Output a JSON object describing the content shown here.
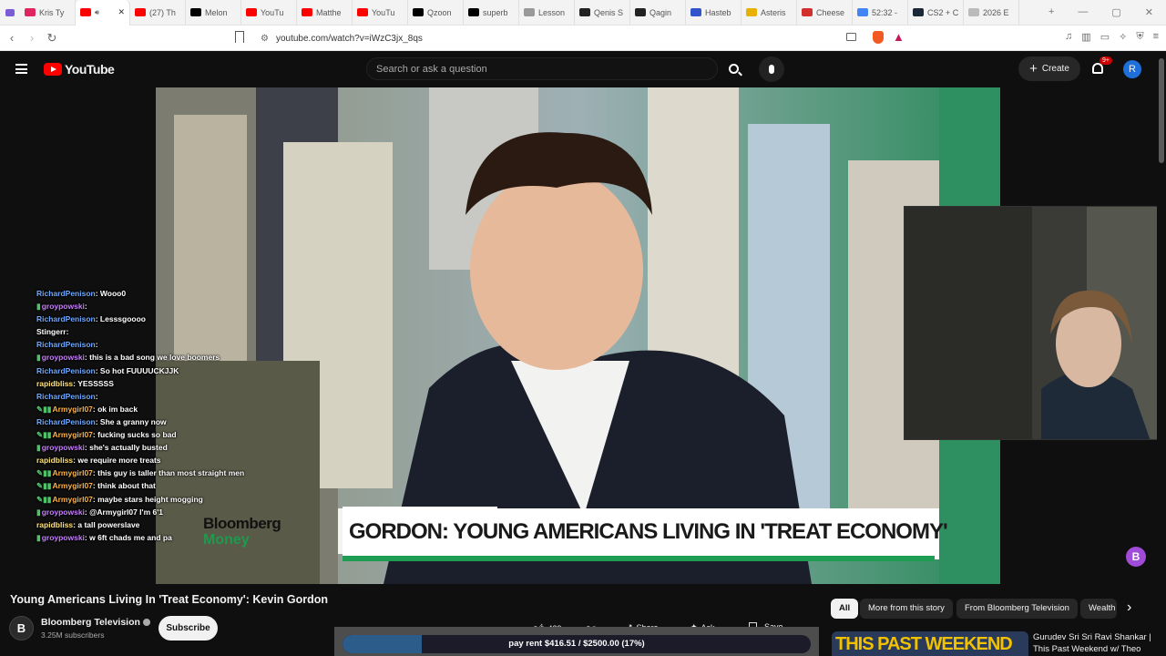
{
  "browser": {
    "tabs": [
      {
        "label": "Kris Ty",
        "color": "#e0245e"
      },
      {
        "label": "",
        "color": "#ff0000",
        "active": true
      },
      {
        "label": "(27) Th",
        "color": "#ff0000"
      },
      {
        "label": "Melon",
        "color": "#000000"
      },
      {
        "label": "YouTu",
        "color": "#ff0000"
      },
      {
        "label": "Matthe",
        "color": "#ff0000"
      },
      {
        "label": "YouTu",
        "color": "#ff0000"
      },
      {
        "label": "Qzoon",
        "color": "#000000"
      },
      {
        "label": "superb",
        "color": "#000000"
      },
      {
        "label": "Lesson",
        "color": "#999999"
      },
      {
        "label": "Qenis S",
        "color": "#222222"
      },
      {
        "label": "Qagin",
        "color": "#222222"
      },
      {
        "label": "Hasteb",
        "color": "#3355cc"
      },
      {
        "label": "Asteris",
        "color": "#e8b100"
      },
      {
        "label": "Cheese",
        "color": "#d32f2f"
      },
      {
        "label": "52:32 -",
        "color": "#4285f4"
      },
      {
        "label": "CS2 + C",
        "color": "#1b2838"
      },
      {
        "label": "2026 E",
        "color": "#bbbbbb"
      }
    ],
    "url": "youtube.com/watch?v=iWzC3jx_8qs"
  },
  "yt": {
    "logo": "YouTube",
    "search_placeholder": "Search or ask a question",
    "create": "Create",
    "notif_count": "9+",
    "avatar": "R"
  },
  "video": {
    "brand_top": "Bloomberg",
    "brand_bottom": "Money",
    "headline": "GORDON: YOUNG AMERICANS LIVING IN 'TREAT ECONOMY'"
  },
  "chat": [
    {
      "user": "RichardPenison",
      "msg": "Wooo0",
      "color": "#6ea8ff",
      "badges": ""
    },
    {
      "user": "groypowski",
      "msg": "",
      "color": "#c77dff",
      "badges": "▮"
    },
    {
      "user": "RichardPenison",
      "msg": "Lesssgoooo",
      "color": "#6ea8ff",
      "badges": ""
    },
    {
      "user": "Stingerr",
      "msg": "",
      "color": "#ffffff",
      "badges": ""
    },
    {
      "user": "RichardPenison",
      "msg": "",
      "color": "#6ea8ff",
      "badges": ""
    },
    {
      "user": "groypowski",
      "msg": "this is a bad song we love boomers",
      "color": "#c77dff",
      "badges": "▮"
    },
    {
      "user": "RichardPenison",
      "msg": "So hot FUUUUCKJJK",
      "color": "#6ea8ff",
      "badges": ""
    },
    {
      "user": "rapidbliss",
      "msg": "YESSSSS",
      "color": "#ffe37a",
      "badges": ""
    },
    {
      "user": "RichardPenison",
      "msg": "",
      "color": "#6ea8ff",
      "badges": ""
    },
    {
      "user": "Armygirl07",
      "msg": "ok im back",
      "color": "#ffb347",
      "badges": "✎▮▮"
    },
    {
      "user": "RichardPenison",
      "msg": "She a granny now",
      "color": "#6ea8ff",
      "badges": ""
    },
    {
      "user": "Armygirl07",
      "msg": "fucking sucks so bad",
      "color": "#ffb347",
      "badges": "✎▮▮"
    },
    {
      "user": "groypowski",
      "msg": "she's actually busted",
      "color": "#c77dff",
      "badges": "▮"
    },
    {
      "user": "rapidbliss",
      "msg": "we require more treats",
      "color": "#ffe37a",
      "badges": ""
    },
    {
      "user": "Armygirl07",
      "msg": "this guy is taller than most straight men",
      "color": "#ffb347",
      "badges": "✎▮▮"
    },
    {
      "user": "Armygirl07",
      "msg": "think about that",
      "color": "#ffb347",
      "badges": "✎▮▮"
    },
    {
      "user": "Armygirl07",
      "msg": "maybe stars height mogging",
      "color": "#ffb347",
      "badges": "✎▮▮"
    },
    {
      "user": "groypowski",
      "msg": "@Armygirl07 I'm 6'1",
      "color": "#c77dff",
      "badges": "▮"
    },
    {
      "user": "rapidbliss",
      "msg": "a tall powerslave",
      "color": "#ffe37a",
      "badges": ""
    },
    {
      "user": "groypowski",
      "msg": "w 6ft chads me and pa",
      "color": "#c77dff",
      "badges": "▮"
    }
  ],
  "title": "Young Americans Living In 'Treat Economy': Kevin Gordon",
  "channel": {
    "name": "Bloomberg Television",
    "subs": "3.25M subscribers",
    "subscribe": "Subscribe",
    "avatar": "B"
  },
  "actions": {
    "likes": "429",
    "share": "Share",
    "ask": "Ask",
    "save": "Save"
  },
  "goal": {
    "text": "pay rent $416.51 / $2500.00 (17%)",
    "fraction": 0.17
  },
  "chips": [
    "All",
    "More from this story",
    "From Bloomberg Television",
    "Wealth"
  ],
  "related": {
    "thumb_text": "THIS PAST WEEKEND",
    "title_line1": "Gurudev Sri Sri Ravi Shankar |",
    "title_line2": "This Past Weekend w/ Theo"
  }
}
